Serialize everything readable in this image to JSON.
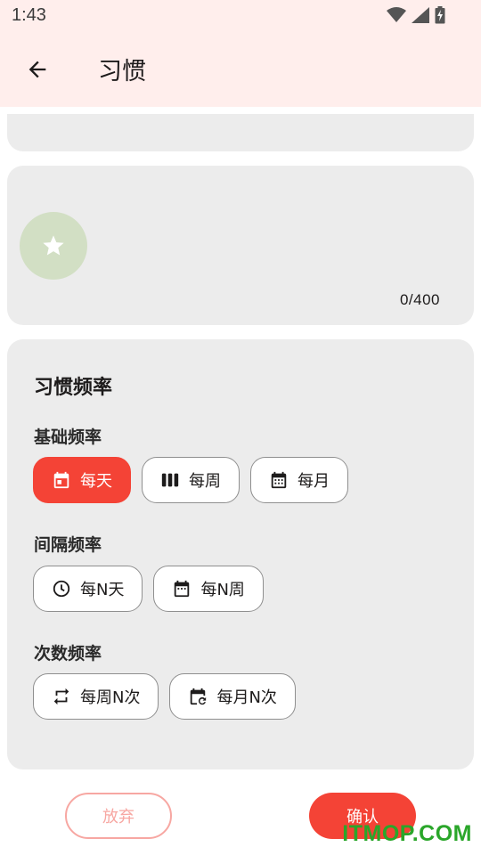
{
  "status_bar": {
    "time": "1:43"
  },
  "app_bar": {
    "title": "习惯"
  },
  "description": {
    "counter": "0/400"
  },
  "frequency": {
    "title": "习惯频率",
    "basic": {
      "label": "基础频率",
      "options": [
        {
          "label": "每天",
          "icon": "calendar-today-icon",
          "selected": true
        },
        {
          "label": "每周",
          "icon": "week-bars-icon",
          "selected": false
        },
        {
          "label": "每月",
          "icon": "calendar-month-icon",
          "selected": false
        }
      ]
    },
    "interval": {
      "label": "间隔频率",
      "options": [
        {
          "label": "每N天",
          "icon": "clock-icon"
        },
        {
          "label": "每N周",
          "icon": "calendar-icon"
        }
      ]
    },
    "count": {
      "label": "次数频率",
      "options": [
        {
          "label": "每周N次",
          "icon": "repeat-icon"
        },
        {
          "label": "每月N次",
          "icon": "calendar-repeat-icon"
        }
      ]
    }
  },
  "actions": {
    "discard": "放弃",
    "confirm": "确认"
  },
  "watermark": "ITMOP.COM",
  "colors": {
    "accent": "#f44336",
    "appbar_bg": "#ffeeec",
    "card_bg": "#ececec",
    "star_circle": "#d2dfc4"
  }
}
